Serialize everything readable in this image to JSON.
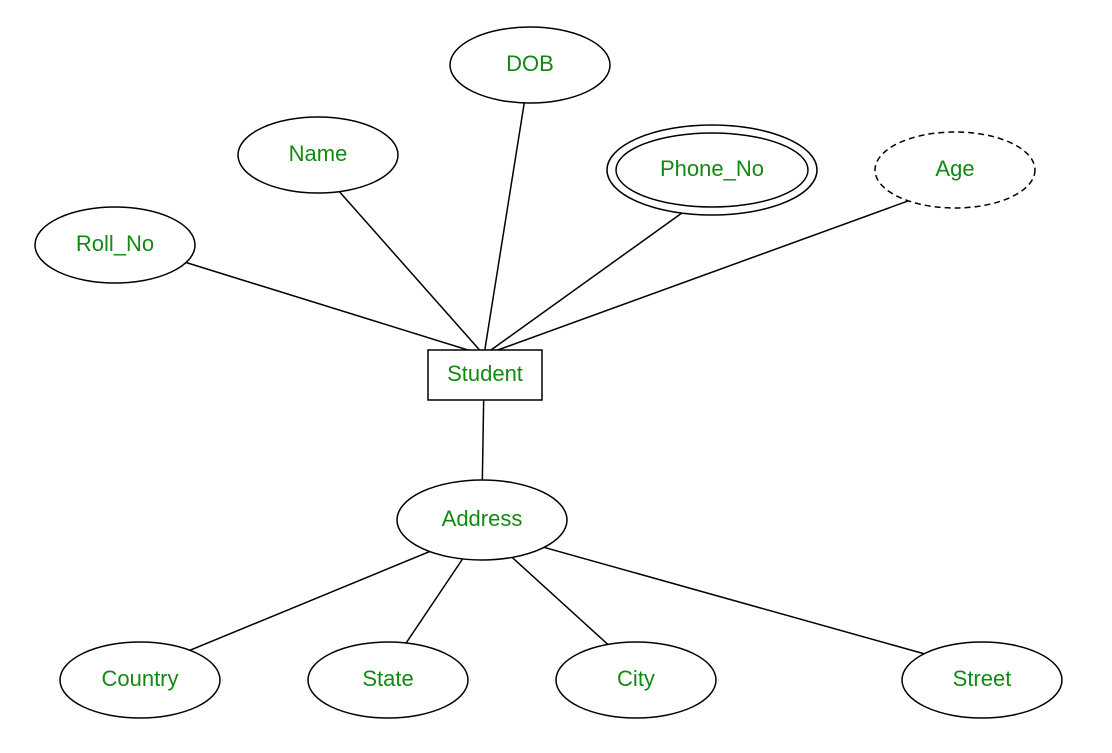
{
  "diagram": {
    "entity": {
      "label": "Student"
    },
    "attributes": {
      "roll_no": {
        "label": "Roll_No"
      },
      "name": {
        "label": "Name"
      },
      "dob": {
        "label": "DOB"
      },
      "phone_no": {
        "label": "Phone_No"
      },
      "age": {
        "label": "Age"
      },
      "address": {
        "label": "Address"
      }
    },
    "sub_attributes": {
      "country": {
        "label": "Country"
      },
      "state": {
        "label": "State"
      },
      "city": {
        "label": "City"
      },
      "street": {
        "label": "Street"
      }
    }
  }
}
